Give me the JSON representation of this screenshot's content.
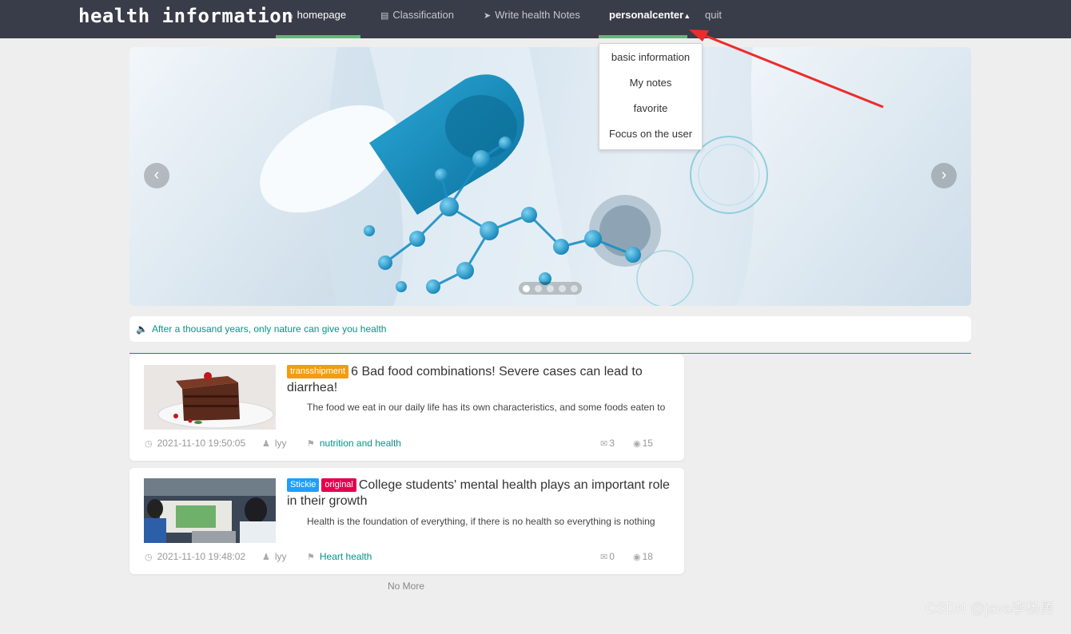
{
  "nav": {
    "brand": "health information",
    "homepage": "homepage",
    "classification": "Classification",
    "write": "Write health Notes",
    "personal": "personalcenter",
    "quit": "quit"
  },
  "dropdown": [
    "basic information",
    "My notes",
    "favorite",
    "Focus on the user"
  ],
  "carousel": {
    "slide_count": 5,
    "active_index": 0,
    "prev": "‹",
    "next": "›"
  },
  "notice": "After a thousand years, only nature can give you health",
  "articles": [
    {
      "tags": [
        {
          "text": "transshipment",
          "color": "#f39c12"
        }
      ],
      "title": "6 Bad food combinations! Severe cases can lead to diarrhea!",
      "summary": "The food we eat in our daily life has its own characteristics, and some foods eaten to",
      "date": "2021-11-10 19:50:05",
      "author": "lyy",
      "category": "nutrition and health",
      "comments": "3",
      "views": "15"
    },
    {
      "tags": [
        {
          "text": "Stickie",
          "color": "#1e9fff"
        },
        {
          "text": "original",
          "color": "#e5004f"
        }
      ],
      "title": "College students' mental health plays an important role in their growth",
      "summary": "Health is the foundation of everything, if there is no health so everything is nothing",
      "date": "2021-11-10 19:48:02",
      "author": "lyy",
      "category": "Heart health",
      "comments": "0",
      "views": "18"
    }
  ],
  "no_more": "No More",
  "watermark": "CSDN @java李杨勇",
  "colors": {
    "nav_bg": "#393d49",
    "accent_green": "#5fb878",
    "teal": "#009688"
  }
}
